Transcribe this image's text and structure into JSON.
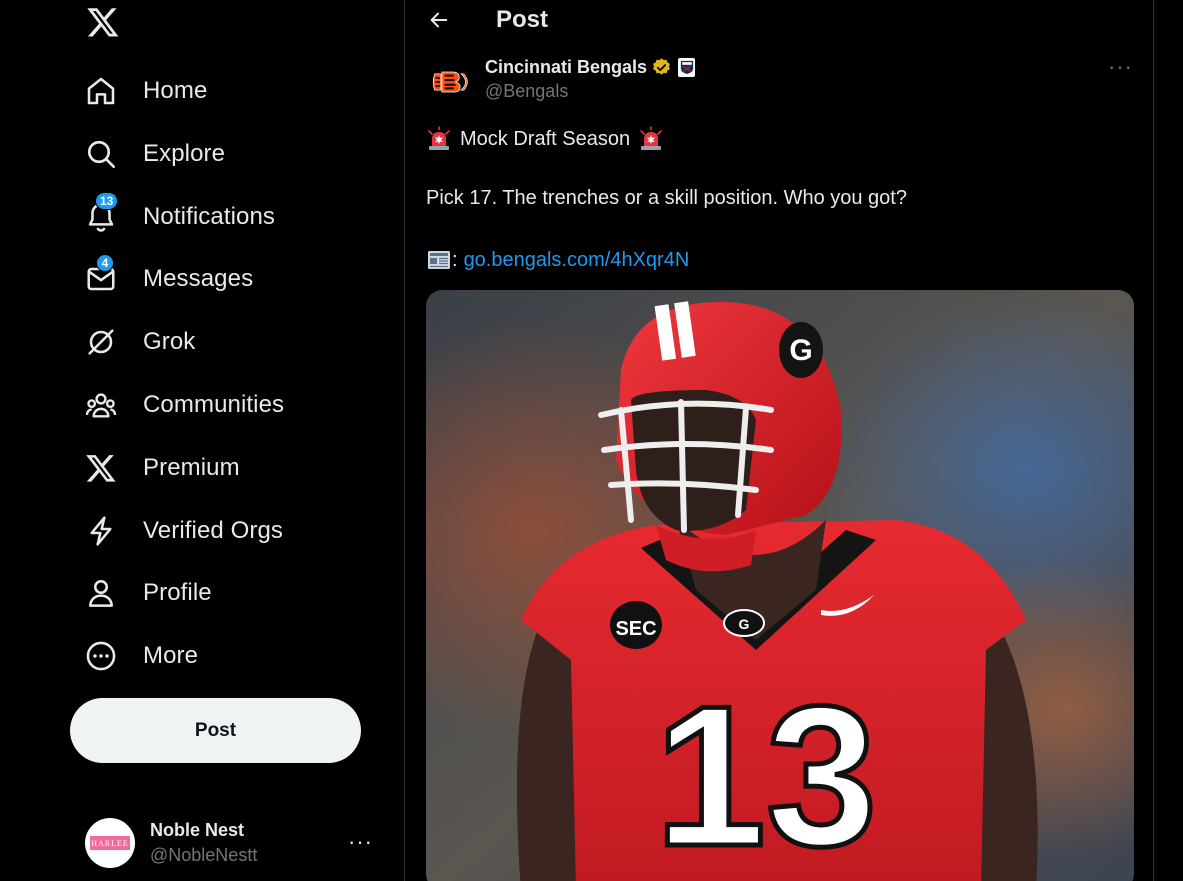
{
  "sidebar": {
    "logo_icon": "x-logo-icon",
    "nav": [
      {
        "id": "home",
        "label": "Home",
        "icon": "home-icon"
      },
      {
        "id": "explore",
        "label": "Explore",
        "icon": "search-icon"
      },
      {
        "id": "notifications",
        "label": "Notifications",
        "icon": "bell-icon",
        "badge": "13"
      },
      {
        "id": "messages",
        "label": "Messages",
        "icon": "envelope-icon",
        "badge": "4"
      },
      {
        "id": "grok",
        "label": "Grok",
        "icon": "grok-icon"
      },
      {
        "id": "communities",
        "label": "Communities",
        "icon": "communities-icon"
      },
      {
        "id": "premium",
        "label": "Premium",
        "icon": "x-logo-icon"
      },
      {
        "id": "verified-orgs",
        "label": "Verified Orgs",
        "icon": "lightning-icon"
      },
      {
        "id": "profile",
        "label": "Profile",
        "icon": "person-icon"
      },
      {
        "id": "more",
        "label": "More",
        "icon": "more-circle-icon"
      }
    ],
    "post_button": "Post",
    "account": {
      "name": "Noble Nest",
      "handle": "@NobleNestt",
      "avatar_text": "HARLEE",
      "more": "···"
    }
  },
  "main": {
    "header": {
      "title": "Post",
      "back_icon": "arrow-left-icon"
    },
    "tweet": {
      "author_name": "Cincinnati Bengals",
      "author_handle": "@Bengals",
      "verified_color": "#e2b719",
      "more": "···",
      "line1": "Mock Draft Season",
      "line2": "Pick 17. The trenches or a skill position. Who you got?",
      "line3_prefix": ":",
      "link": "go.bengals.com/4hXqr4N",
      "media_jersey_number": "13",
      "media_helmet_logo": "G",
      "media_patch": "SEC"
    }
  },
  "colors": {
    "background": "#000000",
    "text": "#e7e9ea",
    "muted": "#71767b",
    "accent": "#1d9bf0",
    "border": "#2f3336"
  }
}
